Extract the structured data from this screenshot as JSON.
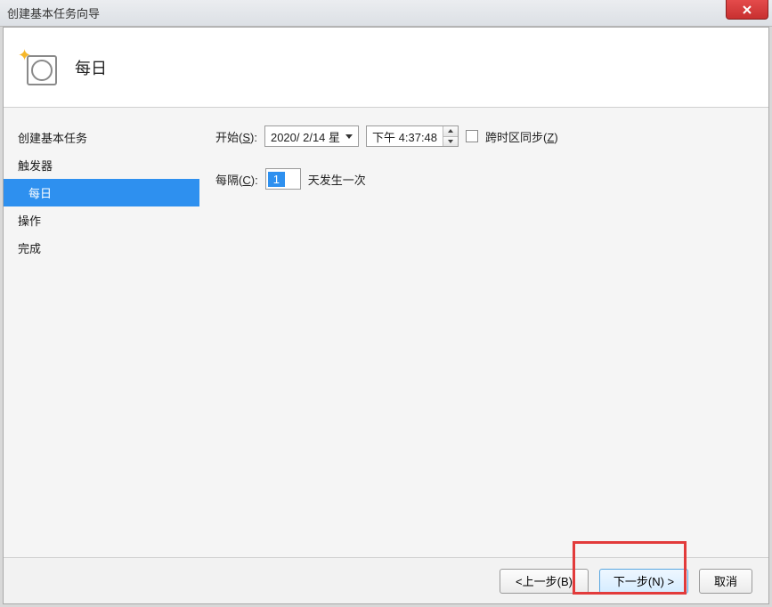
{
  "window": {
    "title": "创建基本任务向导"
  },
  "header": {
    "title": "每日"
  },
  "sidebar": {
    "items": [
      {
        "label": "创建基本任务",
        "indent": false,
        "active": false
      },
      {
        "label": "触发器",
        "indent": false,
        "active": false
      },
      {
        "label": "每日",
        "indent": true,
        "active": true
      },
      {
        "label": "操作",
        "indent": false,
        "active": false
      },
      {
        "label": "完成",
        "indent": false,
        "active": false
      }
    ]
  },
  "form": {
    "start_label_pre": "开始(",
    "start_label_u": "S",
    "start_label_post": "):",
    "date_value": "2020/ 2/14 星",
    "time_value": "下午  4:37:48",
    "sync_label_pre": "跨时区同步(",
    "sync_label_u": "Z",
    "sync_label_post": ")",
    "every_label_pre": "每隔(",
    "every_label_u": "C",
    "every_label_post": "):",
    "every_value": "1",
    "every_suffix": "天发生一次"
  },
  "buttons": {
    "back": "<上一步(B)",
    "next": "下一步(N) >",
    "cancel": "取消"
  }
}
